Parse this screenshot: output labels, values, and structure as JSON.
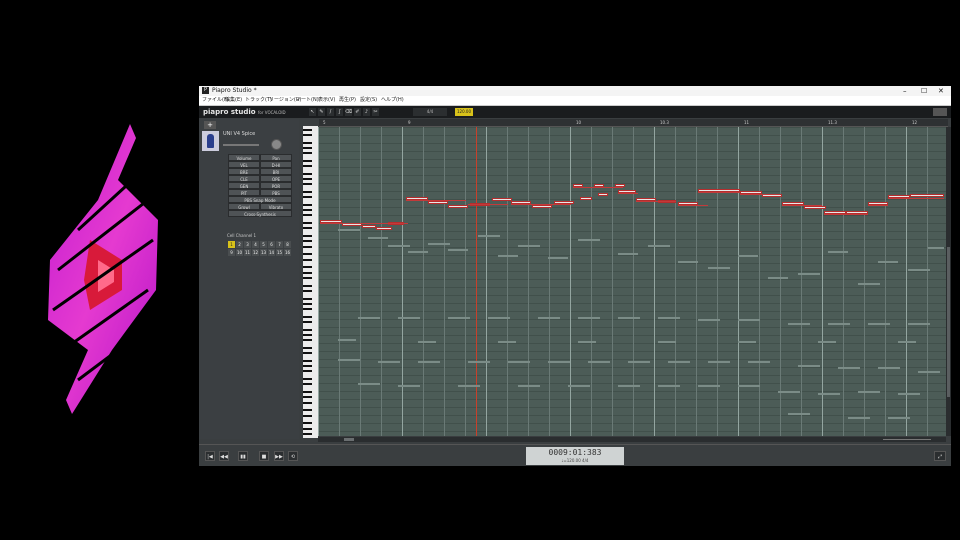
{
  "window": {
    "title": "Piapro Studio *",
    "controls": [
      "–",
      "☐",
      "✕"
    ]
  },
  "menu": [
    "ファイル(F)",
    "編集(E)",
    "トラック(T)",
    "リージョン(R)",
    "ノート(N)",
    "表示(V)",
    "再生(P)",
    "設定(S)",
    "ヘルプ(H)"
  ],
  "toolbar": {
    "brand": "piapro studio",
    "brand_sub": "for VOCALOID",
    "time_signature": "4/4",
    "tempo": "120.00",
    "tool_icons": [
      "pointer-icon",
      "pencil-icon",
      "line-icon",
      "curve-icon",
      "eraser-icon",
      "brush-icon",
      "mute-icon",
      "cut-icon"
    ]
  },
  "ruler": {
    "marks": [
      "5",
      "9",
      "10",
      "10.3",
      "11",
      "11.3",
      "12"
    ]
  },
  "track": {
    "add_label": "+",
    "name": "UNI V4 Spice",
    "params": [
      [
        "Volume",
        "Pan"
      ],
      [
        "VEL",
        "D-HI"
      ],
      [
        "BRE",
        "BRI"
      ],
      [
        "CLE",
        "OPE"
      ],
      [
        "GEN",
        "POR"
      ],
      [
        "PIT",
        "PBS"
      ],
      [
        "PBS Snap Mode",
        ""
      ],
      [
        "Growl",
        "Vibrato"
      ],
      [
        "Cross-Synthesis",
        ""
      ]
    ],
    "channel_label": "Cell Channel 1",
    "channels": [
      "1",
      "2",
      "3",
      "4",
      "5",
      "6",
      "7",
      "8",
      "9",
      "10",
      "11",
      "12",
      "13",
      "14",
      "15",
      "16"
    ]
  },
  "roll": {
    "lyric": "singingsing"
  },
  "transport": {
    "buttons": [
      "|◀",
      "◀◀",
      "▮▮",
      "■",
      "▶▶",
      "⟲"
    ],
    "time": "0009:01:383",
    "sub": "♩=120.00  4/4",
    "fullscreen": "⤢"
  },
  "colors": {
    "accent": "#d8c21a",
    "playhead": "#c8402b",
    "note_border": "#b52d2d",
    "roll_bg": "#4c5c57"
  }
}
